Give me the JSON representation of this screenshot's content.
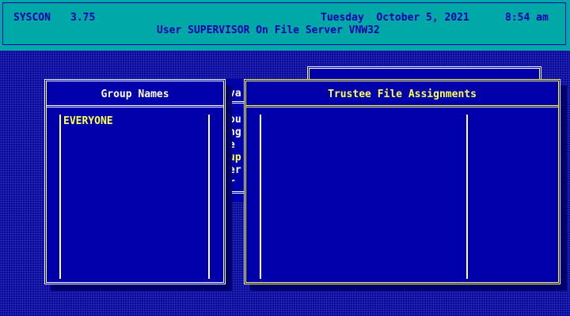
{
  "header": {
    "app_name": "SYSCON",
    "version": "3.75",
    "date": "Tuesday  October 5, 2021",
    "time": "8:54 am",
    "user_line": "User SUPERVISOR On File Server VNW32"
  },
  "group_names": {
    "title": "Group Names",
    "items": [
      "EVERYONE"
    ]
  },
  "background_window": {
    "fragments": [
      "va",
      "ou",
      "ng",
      "e",
      "up",
      "er",
      "r"
    ]
  },
  "trustee_files": {
    "title": "Trustee File Assignments",
    "items": []
  },
  "colors": {
    "header_bg": "#00a8a8",
    "header_text": "#0000aa",
    "desktop_bg": "#0a0a9a",
    "window_bg": "#0000aa",
    "highlight": "#ffff55",
    "border": "#ffffff"
  }
}
